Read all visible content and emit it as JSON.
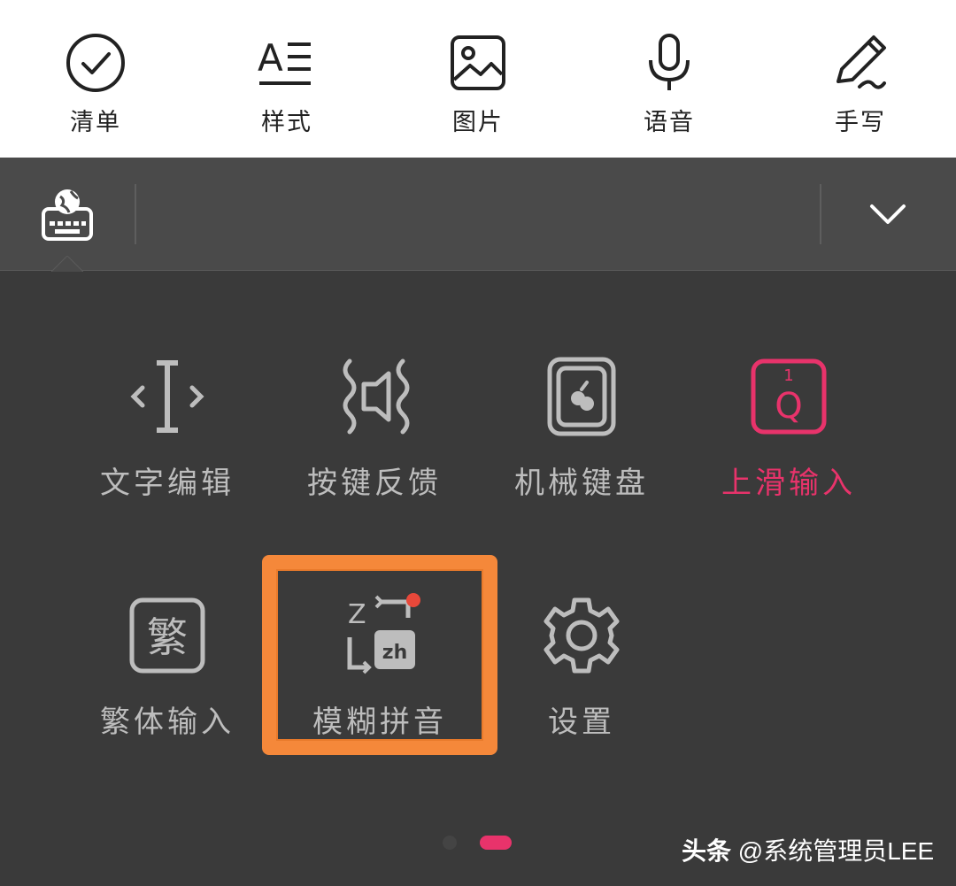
{
  "toolbar": {
    "items": [
      {
        "label": "清单",
        "icon": "checklist-icon"
      },
      {
        "label": "样式",
        "icon": "text-style-icon"
      },
      {
        "label": "图片",
        "icon": "image-icon"
      },
      {
        "label": "语音",
        "icon": "microphone-icon"
      },
      {
        "label": "手写",
        "icon": "pen-icon"
      }
    ]
  },
  "keyboard_bar": {
    "left_icon": "keyboard-language-icon",
    "right_icon": "chevron-down-icon"
  },
  "panel": {
    "items": [
      {
        "label": "文字编辑",
        "icon": "text-cursor-icon",
        "active": false
      },
      {
        "label": "按键反馈",
        "icon": "vibration-sound-icon",
        "active": false
      },
      {
        "label": "机械键盘",
        "icon": "mechanical-key-icon",
        "active": false
      },
      {
        "label": "上滑输入",
        "icon": "swipe-up-key-icon",
        "active": true
      },
      {
        "label": "繁体输入",
        "icon": "traditional-char-icon",
        "glyph": "繁",
        "active": false
      },
      {
        "label": "模糊拼音",
        "icon": "fuzzy-pinyin-icon",
        "glyph": "zh",
        "glyph2": "Z",
        "active": false,
        "badge": true
      },
      {
        "label": "设置",
        "icon": "gear-icon",
        "active": false
      }
    ],
    "swipe_key_glyph": "Q",
    "swipe_key_num": "1"
  },
  "pager": {
    "pages": 2,
    "current": 2
  },
  "watermark": {
    "prefix": "头条",
    "text": " @系统管理员LEE"
  },
  "colors": {
    "accent": "#e8336b",
    "highlight": "#f5883a",
    "badge": "#e8483a",
    "icon_gray": "#bdbdbd"
  }
}
